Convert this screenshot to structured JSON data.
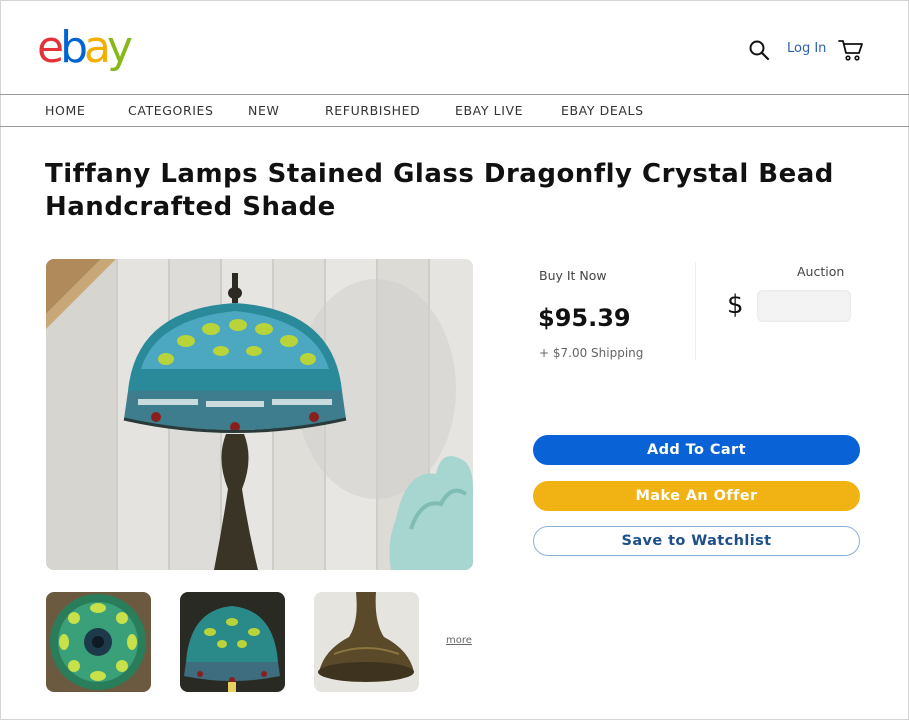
{
  "header": {
    "logo": {
      "e": "e",
      "b": "b",
      "a": "a",
      "y": "y"
    },
    "login_label": "Log In"
  },
  "nav": {
    "items": [
      "HOME",
      "CATEGORIES",
      "NEW",
      "REFURBISHED",
      "EBAY LIVE",
      "EBAY DEALS"
    ]
  },
  "product": {
    "title": "Tiffany Lamps Stained Glass Dragonfly Crystal Bead Handcrafted Shade",
    "more_label": "more"
  },
  "pricing": {
    "buy_now_label": "Buy It Now",
    "price": "$95.39",
    "shipping": "+ $7.00 Shipping",
    "auction_label": "Auction",
    "currency_symbol": "$",
    "bid_value": ""
  },
  "actions": {
    "add_to_cart": "Add To Cart",
    "make_offer": "Make An Offer",
    "watchlist": "Save to Watchlist"
  },
  "colors": {
    "ebay_red": "#e53238",
    "ebay_blue": "#0064d2",
    "ebay_yellow": "#f5af02",
    "ebay_green": "#86b817",
    "cart_button": "#0a63d6",
    "offer_button": "#f1b213"
  },
  "icons": {
    "search": "search-icon",
    "cart": "cart-icon"
  }
}
